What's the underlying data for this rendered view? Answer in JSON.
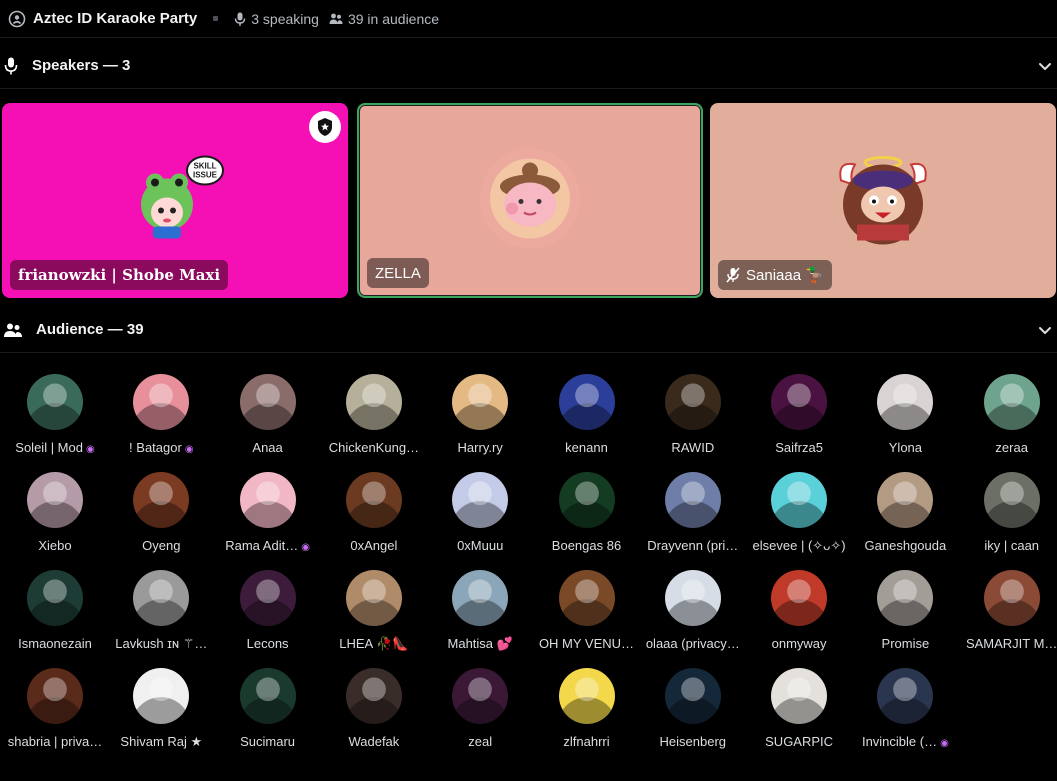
{
  "header": {
    "title": "Aztec ID Karaoke Party",
    "speaking": "3 speaking",
    "audience": "39 in audience"
  },
  "speakers_section": {
    "label": "Speakers — 3"
  },
  "audience_section": {
    "label": "Audience — 39"
  },
  "speakers": [
    {
      "name": "frianowzki | Shobe Maxi",
      "bg": "#f410b5",
      "avatar": "frog-avatar",
      "moderator": true,
      "speaking": false
    },
    {
      "name": "ZELLA",
      "bg": "#e8a79b",
      "avatar": "pink-character-avatar",
      "moderator": false,
      "speaking": true
    },
    {
      "name": "Saniaaa 🦆",
      "bg": "#e2ae9c",
      "avatar": "angel-character-avatar",
      "moderator": false,
      "speaking": false,
      "muted": true
    }
  ],
  "audience": [
    {
      "name": "Soleil | Mod",
      "nitro": true,
      "color": "#3a6a5a"
    },
    {
      "name": "! Batagor",
      "nitro": true,
      "color": "#e7909c"
    },
    {
      "name": "Anaa",
      "nitro": false,
      "color": "#8a6d6a"
    },
    {
      "name": "ChickenKung…",
      "nitro": false,
      "color": "#b6b09b"
    },
    {
      "name": "Harry.ry",
      "nitro": false,
      "color": "#e4b983"
    },
    {
      "name": "kenann",
      "nitro": false,
      "color": "#2a3e9a"
    },
    {
      "name": "RAWID",
      "nitro": false,
      "color": "#3a2a1c"
    },
    {
      "name": "Saifrza5",
      "nitro": false,
      "color": "#4a1240"
    },
    {
      "name": "Ylona",
      "nitro": false,
      "color": "#d9d3d3"
    },
    {
      "name": "zeraa",
      "nitro": false,
      "color": "#6ea48e"
    },
    {
      "name": "Xiebo",
      "nitro": false,
      "color": "#b59aa8"
    },
    {
      "name": "Oyeng",
      "nitro": false,
      "color": "#7b3a22"
    },
    {
      "name": "Rama Adit…",
      "nitro": true,
      "color": "#f2b7c4"
    },
    {
      "name": "0xAngel",
      "nitro": false,
      "color": "#6b3a20"
    },
    {
      "name": "0xMuuu",
      "nitro": false,
      "color": "#c4cbe8"
    },
    {
      "name": "Boengas 86",
      "nitro": false,
      "color": "#143c22"
    },
    {
      "name": "Drayvenn (pri…",
      "nitro": false,
      "color": "#6e7ea8"
    },
    {
      "name": "elsevee | (✧ᴗ✧)",
      "nitro": false,
      "color": "#5ad0d8"
    },
    {
      "name": "Ganeshgouda",
      "nitro": false,
      "color": "#b39a82"
    },
    {
      "name": "iky | caan",
      "nitro": false,
      "color": "#6c6f66"
    },
    {
      "name": "Ismaonezain",
      "nitro": false,
      "color": "#1d3c36"
    },
    {
      "name": "Lavkush ɪɴ ⚚…",
      "nitro": false,
      "color": "#9a9a9a"
    },
    {
      "name": "Lecons",
      "nitro": false,
      "color": "#3c1c3a"
    },
    {
      "name": "LHEA 🥀👠",
      "nitro": false,
      "color": "#b08b6a"
    },
    {
      "name": "Mahtisa 💕",
      "nitro": false,
      "color": "#8aa6b8"
    },
    {
      "name": "OH MY VENU…",
      "nitro": false,
      "color": "#7a4a28"
    },
    {
      "name": "olaaa (privacy…",
      "nitro": false,
      "color": "#d6dde6"
    },
    {
      "name": "onmyway",
      "nitro": false,
      "color": "#c03a2a"
    },
    {
      "name": "Promise",
      "nitro": false,
      "color": "#a39d98"
    },
    {
      "name": "SAMARJIT M…",
      "nitro": false,
      "color": "#8a4a36"
    },
    {
      "name": "shabria | priva…",
      "nitro": false,
      "color": "#5a2a1a"
    },
    {
      "name": "Shivam Raj ★",
      "nitro": false,
      "color": "#f0f0f0"
    },
    {
      "name": "Sucimaru",
      "nitro": false,
      "color": "#1a3a2e"
    },
    {
      "name": "Wadefak",
      "nitro": false,
      "color": "#3a2c28"
    },
    {
      "name": "zeal",
      "nitro": false,
      "color": "#3a1836"
    },
    {
      "name": "zlfnahrri",
      "nitro": false,
      "color": "#f2d84a"
    },
    {
      "name": "Heisenberg",
      "nitro": false,
      "color": "#14283a"
    },
    {
      "name": "SUGARPIC",
      "nitro": false,
      "color": "#e4e0dc"
    },
    {
      "name": "Invincible (…",
      "nitro": true,
      "color": "#2a3550"
    }
  ],
  "nitro_symbol": "◉"
}
